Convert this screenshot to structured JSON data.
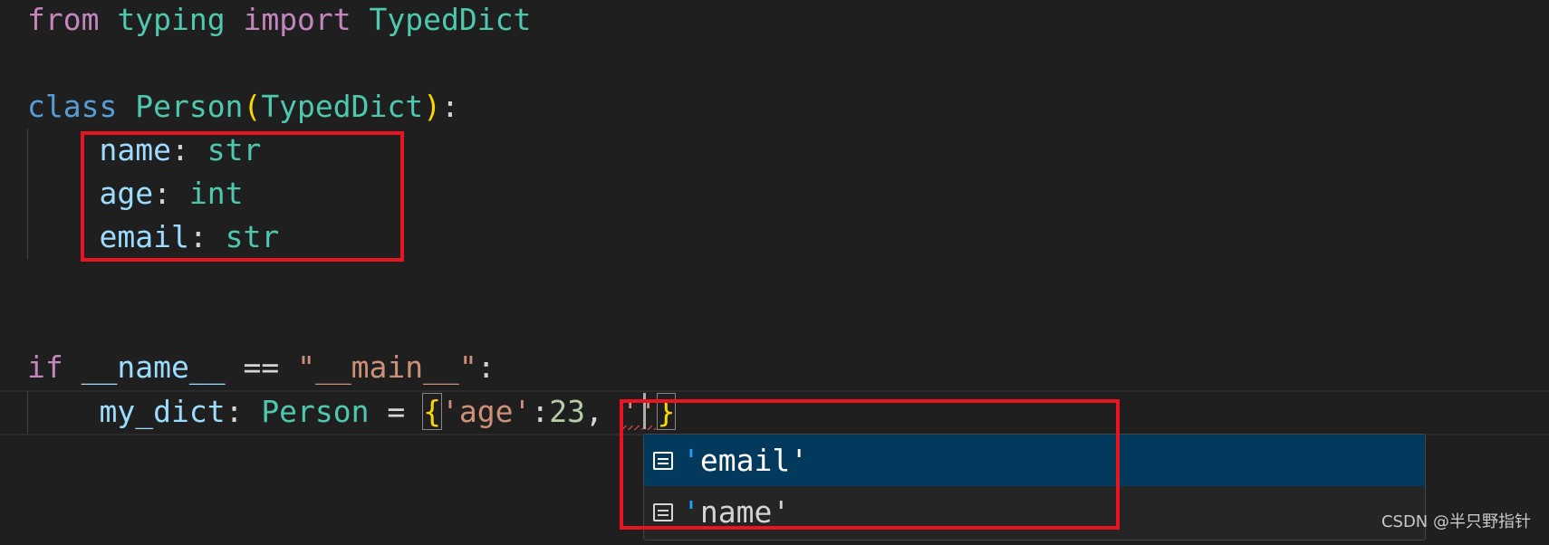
{
  "code": {
    "line1": {
      "kw_from": "from",
      "module": "typing",
      "kw_import": "import",
      "name": "TypedDict"
    },
    "line3": {
      "kw_class": "class",
      "name": "Person",
      "open": "(",
      "base": "TypedDict",
      "close": ")",
      "colon": ":"
    },
    "fields": [
      {
        "name": "name",
        "colon": ":",
        "type": "str"
      },
      {
        "name": "age",
        "colon": ":",
        "type": "int"
      },
      {
        "name": "email",
        "colon": ":",
        "type": "str"
      }
    ],
    "line9": {
      "kw_if": "if",
      "var": "__name__",
      "op": "==",
      "str": "\"__main__\"",
      "colon": ":"
    },
    "line10": {
      "var": "my_dict",
      "colon": ":",
      "type": "Person",
      "eq": "=",
      "open_brace": "{",
      "key": "'age'",
      "sep": ":",
      "value": "23",
      "comma": ",",
      "typed": "''",
      "close_brace": "}"
    }
  },
  "suggestions": [
    {
      "label": "email",
      "selected": true,
      "icon": "field-icon"
    },
    {
      "label": "name",
      "selected": false,
      "icon": "field-icon"
    }
  ],
  "watermark": "CSDN @半只野指针",
  "colors": {
    "background": "#1f1f1f",
    "highlight_box": "#e8141f",
    "selected_suggestion": "#04395E"
  }
}
